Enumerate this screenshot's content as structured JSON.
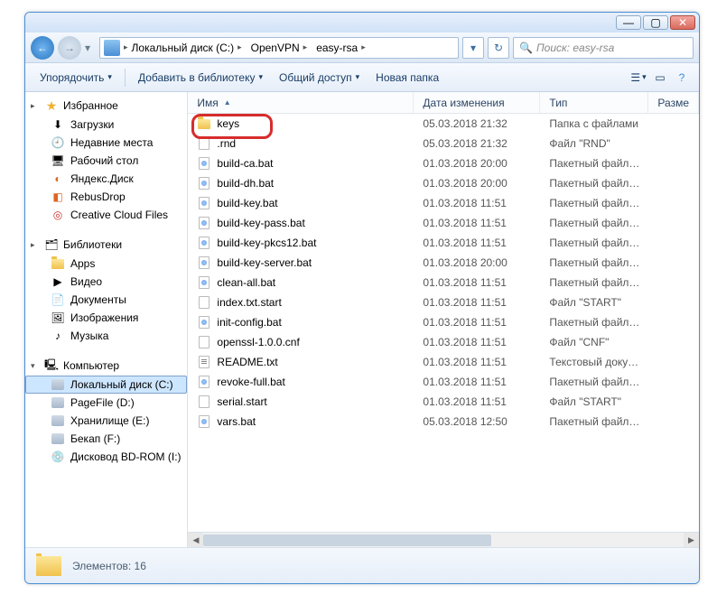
{
  "titlebar": {
    "min": "—",
    "max": "▢",
    "close": "✕"
  },
  "nav": {
    "breadcrumb": [
      "Локальный диск (C:)",
      "OpenVPN",
      "easy-rsa"
    ],
    "search_placeholder": "Поиск: easy-rsa"
  },
  "toolbar": {
    "organize": "Упорядочить",
    "include": "Добавить в библиотеку",
    "share": "Общий доступ",
    "newfolder": "Новая папка"
  },
  "sidebar": {
    "favorites": {
      "label": "Избранное",
      "items": [
        "Загрузки",
        "Недавние места",
        "Рабочий стол",
        "Яндекс.Диск",
        "RebusDrop",
        "Creative Cloud Files"
      ]
    },
    "libraries": {
      "label": "Библиотеки",
      "items": [
        "Apps",
        "Видео",
        "Документы",
        "Изображения",
        "Музыка"
      ]
    },
    "computer": {
      "label": "Компьютер",
      "items": [
        "Локальный диск (C:)",
        "PageFile (D:)",
        "Хранилище (E:)",
        "Бекап (F:)",
        "Дисковод BD-ROM (I:)"
      ]
    }
  },
  "columns": {
    "name": "Имя",
    "date": "Дата изменения",
    "type": "Тип",
    "size": "Разме"
  },
  "files": [
    {
      "name": "keys",
      "date": "05.03.2018 21:32",
      "type": "Папка с файлами",
      "icon": "folder"
    },
    {
      "name": ".rnd",
      "date": "05.03.2018 21:32",
      "type": "Файл \"RND\"",
      "icon": "file"
    },
    {
      "name": "build-ca.bat",
      "date": "01.03.2018 20:00",
      "type": "Пакетный файл ...",
      "icon": "bat"
    },
    {
      "name": "build-dh.bat",
      "date": "01.03.2018 20:00",
      "type": "Пакетный файл ...",
      "icon": "bat"
    },
    {
      "name": "build-key.bat",
      "date": "01.03.2018 11:51",
      "type": "Пакетный файл ...",
      "icon": "bat"
    },
    {
      "name": "build-key-pass.bat",
      "date": "01.03.2018 11:51",
      "type": "Пакетный файл ...",
      "icon": "bat"
    },
    {
      "name": "build-key-pkcs12.bat",
      "date": "01.03.2018 11:51",
      "type": "Пакетный файл ...",
      "icon": "bat"
    },
    {
      "name": "build-key-server.bat",
      "date": "01.03.2018 20:00",
      "type": "Пакетный файл ...",
      "icon": "bat"
    },
    {
      "name": "clean-all.bat",
      "date": "01.03.2018 11:51",
      "type": "Пакетный файл ...",
      "icon": "bat"
    },
    {
      "name": "index.txt.start",
      "date": "01.03.2018 11:51",
      "type": "Файл \"START\"",
      "icon": "file"
    },
    {
      "name": "init-config.bat",
      "date": "01.03.2018 11:51",
      "type": "Пакетный файл ...",
      "icon": "bat"
    },
    {
      "name": "openssl-1.0.0.cnf",
      "date": "01.03.2018 11:51",
      "type": "Файл \"CNF\"",
      "icon": "file"
    },
    {
      "name": "README.txt",
      "date": "01.03.2018 11:51",
      "type": "Текстовый докум...",
      "icon": "txt"
    },
    {
      "name": "revoke-full.bat",
      "date": "01.03.2018 11:51",
      "type": "Пакетный файл ...",
      "icon": "bat"
    },
    {
      "name": "serial.start",
      "date": "01.03.2018 11:51",
      "type": "Файл \"START\"",
      "icon": "file"
    },
    {
      "name": "vars.bat",
      "date": "05.03.2018 12:50",
      "type": "Пакетный файл ...",
      "icon": "bat"
    }
  ],
  "status": {
    "label": "Элементов:",
    "count": "16"
  }
}
